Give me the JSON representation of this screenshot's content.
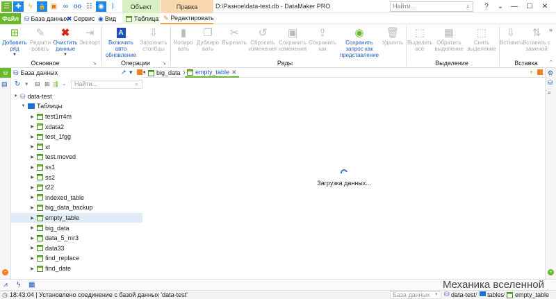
{
  "window": {
    "file_path": "D:\\Разное\\data-test.db",
    "app_name": "DataMaker PRO",
    "separator": " - ",
    "search_placeholder": "Найти..."
  },
  "context_tabs": {
    "object": "Объект",
    "edit": "Правка"
  },
  "ribbon_tabs": {
    "file": "Файл",
    "database": "База данных",
    "service": "Сервис",
    "view": "Вид",
    "table": "Таблица",
    "edit": "Редактировать"
  },
  "ribbon": {
    "add_row": [
      "Добавить",
      "ряд"
    ],
    "edit_row": [
      "Редакти",
      "ровать"
    ],
    "clear_data": [
      "Очистить",
      "данные"
    ],
    "export": [
      "Экспорт"
    ],
    "auto_refresh": [
      "Включить",
      "авто",
      "обновление"
    ],
    "fill_columns": [
      "Заполнить",
      "столбцы"
    ],
    "copy": [
      "Копиро",
      "вать"
    ],
    "duplicate": [
      "Дублиро",
      "вать"
    ],
    "cut": [
      "Вырезать"
    ],
    "reset_changes": [
      "Сбросить",
      "изменения"
    ],
    "save_changes": [
      "Сохранить",
      "изменения"
    ],
    "save_as": [
      "Сохранить",
      "как"
    ],
    "save_query_view": [
      "Сохранить",
      "запрос как",
      "представление"
    ],
    "delete": [
      "Удалить"
    ],
    "select_all": [
      "Выделить",
      "всё"
    ],
    "invert_selection": [
      "Обратить",
      "выделение"
    ],
    "clear_selection": [
      "Снять",
      "выделение"
    ],
    "paste": [
      "Вставить"
    ],
    "paste_replace": [
      "Вставить с",
      "заменой"
    ],
    "groups": {
      "basic": "Основное",
      "operations": "Операции",
      "rows": "Ряды",
      "selection": "Выделение",
      "paste": "Вставка"
    }
  },
  "db_panel": {
    "title": "База данных",
    "search_placeholder": "Найти...",
    "root": "data-test",
    "folder": "Таблицы",
    "tables": [
      "test1rr4m",
      "xdata2",
      "test_1fgg",
      "xt",
      "test.moved",
      "ss1",
      "ss2",
      "t22",
      "indexed_table",
      "big_data_backup",
      "empty_table",
      "big_data",
      "data_5_mr3",
      "data33",
      "find_replace",
      "find_date"
    ],
    "selected": "empty_table"
  },
  "doc_tabs": [
    {
      "label": "big_data",
      "active": false
    },
    {
      "label": "empty_table",
      "active": true
    }
  ],
  "loading_text": "Загрузка данных...",
  "status": {
    "message": "18:43:04 | Установлено соединение с базой данных 'data-test'",
    "search_placeholder": "База данных",
    "crumb_db": "data-test",
    "crumb_sep": "/",
    "crumb_folder": "tables",
    "crumb_table": "empty_table"
  },
  "watermark": "Механика вселенной",
  "colors": {
    "accent_green": "#68b828",
    "context_edit": "#f9d8b0",
    "context_object": "#d8f0c4",
    "link_blue": "#1f5fbf"
  }
}
